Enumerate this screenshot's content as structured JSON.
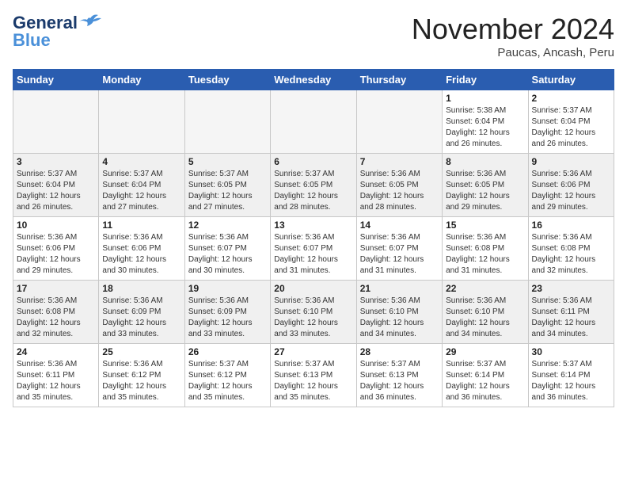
{
  "header": {
    "logo_general": "General",
    "logo_blue": "Blue",
    "month_title": "November 2024",
    "location": "Paucas, Ancash, Peru"
  },
  "days_of_week": [
    "Sunday",
    "Monday",
    "Tuesday",
    "Wednesday",
    "Thursday",
    "Friday",
    "Saturday"
  ],
  "weeks": [
    [
      {
        "day": "",
        "info": ""
      },
      {
        "day": "",
        "info": ""
      },
      {
        "day": "",
        "info": ""
      },
      {
        "day": "",
        "info": ""
      },
      {
        "day": "",
        "info": ""
      },
      {
        "day": "1",
        "info": "Sunrise: 5:38 AM\nSunset: 6:04 PM\nDaylight: 12 hours and 26 minutes."
      },
      {
        "day": "2",
        "info": "Sunrise: 5:37 AM\nSunset: 6:04 PM\nDaylight: 12 hours and 26 minutes."
      }
    ],
    [
      {
        "day": "3",
        "info": "Sunrise: 5:37 AM\nSunset: 6:04 PM\nDaylight: 12 hours and 26 minutes."
      },
      {
        "day": "4",
        "info": "Sunrise: 5:37 AM\nSunset: 6:04 PM\nDaylight: 12 hours and 27 minutes."
      },
      {
        "day": "5",
        "info": "Sunrise: 5:37 AM\nSunset: 6:05 PM\nDaylight: 12 hours and 27 minutes."
      },
      {
        "day": "6",
        "info": "Sunrise: 5:37 AM\nSunset: 6:05 PM\nDaylight: 12 hours and 28 minutes."
      },
      {
        "day": "7",
        "info": "Sunrise: 5:36 AM\nSunset: 6:05 PM\nDaylight: 12 hours and 28 minutes."
      },
      {
        "day": "8",
        "info": "Sunrise: 5:36 AM\nSunset: 6:05 PM\nDaylight: 12 hours and 29 minutes."
      },
      {
        "day": "9",
        "info": "Sunrise: 5:36 AM\nSunset: 6:06 PM\nDaylight: 12 hours and 29 minutes."
      }
    ],
    [
      {
        "day": "10",
        "info": "Sunrise: 5:36 AM\nSunset: 6:06 PM\nDaylight: 12 hours and 29 minutes."
      },
      {
        "day": "11",
        "info": "Sunrise: 5:36 AM\nSunset: 6:06 PM\nDaylight: 12 hours and 30 minutes."
      },
      {
        "day": "12",
        "info": "Sunrise: 5:36 AM\nSunset: 6:07 PM\nDaylight: 12 hours and 30 minutes."
      },
      {
        "day": "13",
        "info": "Sunrise: 5:36 AM\nSunset: 6:07 PM\nDaylight: 12 hours and 31 minutes."
      },
      {
        "day": "14",
        "info": "Sunrise: 5:36 AM\nSunset: 6:07 PM\nDaylight: 12 hours and 31 minutes."
      },
      {
        "day": "15",
        "info": "Sunrise: 5:36 AM\nSunset: 6:08 PM\nDaylight: 12 hours and 31 minutes."
      },
      {
        "day": "16",
        "info": "Sunrise: 5:36 AM\nSunset: 6:08 PM\nDaylight: 12 hours and 32 minutes."
      }
    ],
    [
      {
        "day": "17",
        "info": "Sunrise: 5:36 AM\nSunset: 6:08 PM\nDaylight: 12 hours and 32 minutes."
      },
      {
        "day": "18",
        "info": "Sunrise: 5:36 AM\nSunset: 6:09 PM\nDaylight: 12 hours and 33 minutes."
      },
      {
        "day": "19",
        "info": "Sunrise: 5:36 AM\nSunset: 6:09 PM\nDaylight: 12 hours and 33 minutes."
      },
      {
        "day": "20",
        "info": "Sunrise: 5:36 AM\nSunset: 6:10 PM\nDaylight: 12 hours and 33 minutes."
      },
      {
        "day": "21",
        "info": "Sunrise: 5:36 AM\nSunset: 6:10 PM\nDaylight: 12 hours and 34 minutes."
      },
      {
        "day": "22",
        "info": "Sunrise: 5:36 AM\nSunset: 6:10 PM\nDaylight: 12 hours and 34 minutes."
      },
      {
        "day": "23",
        "info": "Sunrise: 5:36 AM\nSunset: 6:11 PM\nDaylight: 12 hours and 34 minutes."
      }
    ],
    [
      {
        "day": "24",
        "info": "Sunrise: 5:36 AM\nSunset: 6:11 PM\nDaylight: 12 hours and 35 minutes."
      },
      {
        "day": "25",
        "info": "Sunrise: 5:36 AM\nSunset: 6:12 PM\nDaylight: 12 hours and 35 minutes."
      },
      {
        "day": "26",
        "info": "Sunrise: 5:37 AM\nSunset: 6:12 PM\nDaylight: 12 hours and 35 minutes."
      },
      {
        "day": "27",
        "info": "Sunrise: 5:37 AM\nSunset: 6:13 PM\nDaylight: 12 hours and 35 minutes."
      },
      {
        "day": "28",
        "info": "Sunrise: 5:37 AM\nSunset: 6:13 PM\nDaylight: 12 hours and 36 minutes."
      },
      {
        "day": "29",
        "info": "Sunrise: 5:37 AM\nSunset: 6:14 PM\nDaylight: 12 hours and 36 minutes."
      },
      {
        "day": "30",
        "info": "Sunrise: 5:37 AM\nSunset: 6:14 PM\nDaylight: 12 hours and 36 minutes."
      }
    ]
  ]
}
